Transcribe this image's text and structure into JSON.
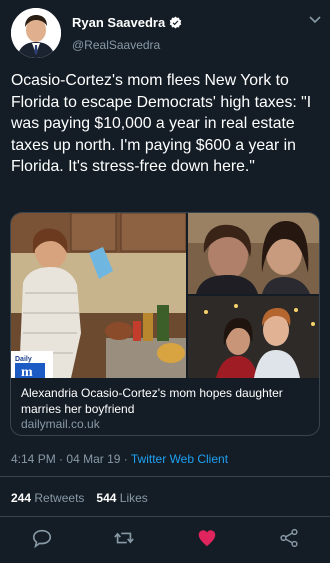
{
  "author": {
    "name": "Ryan Saavedra",
    "handle": "@RealSaavedra",
    "verified_icon": "verified-badge-icon"
  },
  "tweet": {
    "text": "Ocasio-Cortez's mom flees New York to Florida to escape Democrats' high taxes: \"I was paying $10,000 a year in real estate taxes up north. I'm paying $600 a year in Florida. It's stress-free down here.\""
  },
  "card": {
    "title": "Alexandria Ocasio-Cortez's mom hopes daughter marries her boyfriend",
    "domain": "dailymail.co.uk",
    "publisher_badge": "Daily"
  },
  "meta": {
    "time": "4:14 PM",
    "date": "04 Mar 19",
    "client": "Twitter Web Client",
    "separator": "·"
  },
  "stats": {
    "retweets_count": "244",
    "retweets_label": "Retweets",
    "likes_count": "544",
    "likes_label": "Likes"
  },
  "actions": {
    "reply_icon": "reply-icon",
    "retweet_icon": "retweet-icon",
    "like_icon": "heart-icon",
    "share_icon": "share-icon",
    "like_color": "#e0245e",
    "icon_color": "#8899a6"
  },
  "colors": {
    "background": "#141d26",
    "secondary_text": "#8899a6",
    "link": "#1da1f2",
    "border": "#38444d"
  }
}
